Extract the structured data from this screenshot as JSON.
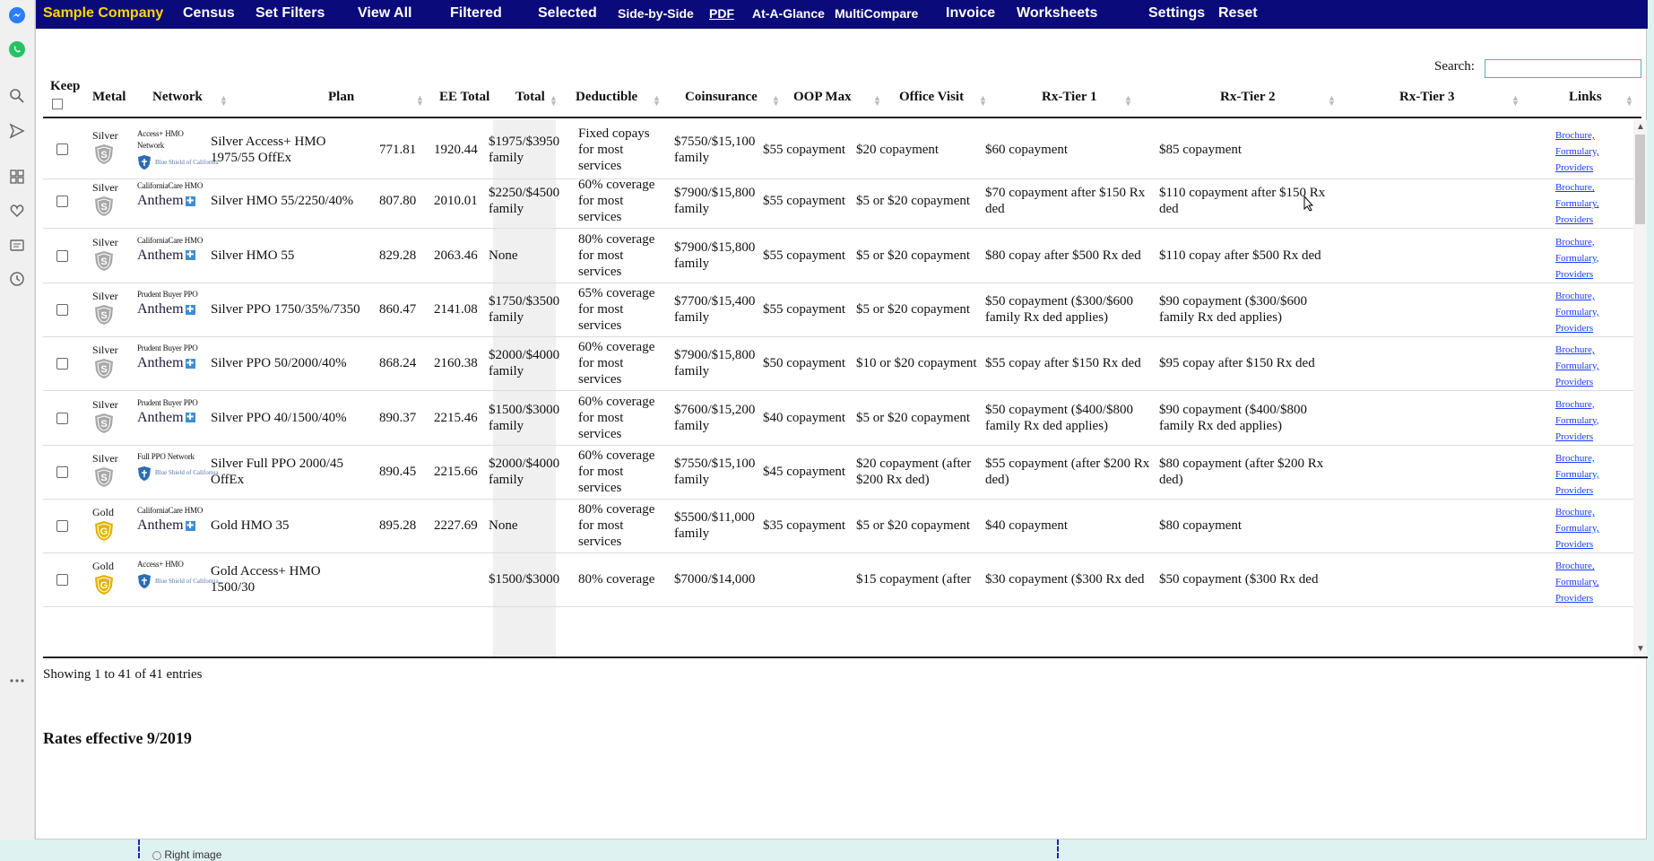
{
  "nav": {
    "items": [
      {
        "label": "Sample Company",
        "brand": true
      },
      {
        "label": "Census"
      },
      {
        "label": "Set Filters"
      },
      {
        "label": "View All"
      },
      {
        "label": "Filtered"
      },
      {
        "label": "Selected"
      },
      {
        "label": "Side-by-Side",
        "small": true
      },
      {
        "label": "PDF",
        "small": true,
        "underline": true
      },
      {
        "label": "At-A-Glance",
        "small": true
      },
      {
        "label": "MultiCompare",
        "small": true
      },
      {
        "label": "Invoice"
      },
      {
        "label": "Worksheets"
      },
      {
        "label": "Settings"
      },
      {
        "label": "Reset"
      }
    ]
  },
  "search": {
    "label": "Search:",
    "value": ""
  },
  "table": {
    "headers": [
      "Keep",
      "Metal",
      "Network",
      "Plan",
      "EE Total",
      "Total",
      "Deductible",
      "Coinsurance",
      "OOP Max",
      "Office Visit",
      "Rx-Tier 1",
      "Rx-Tier 2",
      "Rx-Tier 3",
      "Links"
    ],
    "rows": [
      {
        "metal": "Silver",
        "network": [
          "Access+ HMO",
          "Network"
        ],
        "carrier": "Blue Shield of California",
        "plan": "Silver Access+ HMO 1975/55 OffEx",
        "ee_total": "771.81",
        "total": "1920.44",
        "deductible": "$1975/$3950 family",
        "coinsurance": "Fixed copays for most services",
        "oop_max": "$7550/$15,100 family",
        "office_visit": "$55 copayment",
        "rx1": "$20 copayment",
        "rx2": "$60 copayment",
        "rx3": "$85 copayment"
      },
      {
        "metal": "Silver",
        "network": [
          "CaliforniaCare HMO"
        ],
        "carrier": "Anthem",
        "plan": "Silver HMO 55/2250/40%",
        "ee_total": "807.80",
        "total": "2010.01",
        "deductible": "$2250/$4500 family",
        "coinsurance": "60% coverage for most services",
        "oop_max": "$7900/$15,800 family",
        "office_visit": "$55 copayment",
        "rx1": "$5 or $20 copayment",
        "rx2": "$70 copayment after $150 Rx ded",
        "rx3": "$110 copayment after $150 Rx ded"
      },
      {
        "metal": "Silver",
        "network": [
          "CaliforniaCare HMO"
        ],
        "carrier": "Anthem",
        "plan": "Silver HMO 55",
        "ee_total": "829.28",
        "total": "2063.46",
        "deductible": "None",
        "coinsurance": "80% coverage for most services",
        "oop_max": "$7900/$15,800 family",
        "office_visit": "$55 copayment",
        "rx1": "$5 or $20 copayment",
        "rx2": "$80 copay after $500 Rx ded",
        "rx3": "$110 copay after $500 Rx ded"
      },
      {
        "metal": "Silver",
        "network": [
          "Prudent Buyer PPO"
        ],
        "carrier": "Anthem",
        "plan": "Silver PPO 1750/35%/7350",
        "ee_total": "860.47",
        "total": "2141.08",
        "deductible": "$1750/$3500 family",
        "coinsurance": "65% coverage for most services",
        "oop_max": "$7700/$15,400 family",
        "office_visit": "$55 copayment",
        "rx1": "$5 or $20 copayment",
        "rx2": "$50 copayment ($300/$600 family Rx ded applies)",
        "rx3": "$90 copayment ($300/$600 family Rx ded applies)"
      },
      {
        "metal": "Silver",
        "network": [
          "Prudent Buyer PPO"
        ],
        "carrier": "Anthem",
        "plan": "Silver PPO 50/2000/40%",
        "ee_total": "868.24",
        "total": "2160.38",
        "deductible": "$2000/$4000 family",
        "coinsurance": "60% coverage for most services",
        "oop_max": "$7900/$15,800 family",
        "office_visit": "$50 copayment",
        "rx1": "$10 or $20 copayment",
        "rx2": "$55 copay after $150 Rx ded",
        "rx3": "$95 copay after $150 Rx ded"
      },
      {
        "metal": "Silver",
        "network": [
          "Prudent Buyer PPO"
        ],
        "carrier": "Anthem",
        "plan": "Silver PPO 40/1500/40%",
        "ee_total": "890.37",
        "total": "2215.46",
        "deductible": "$1500/$3000 family",
        "coinsurance": "60% coverage for most services",
        "oop_max": "$7600/$15,200 family",
        "office_visit": "$40 copayment",
        "rx1": "$5 or $20 copayment",
        "rx2": "$50 copayment ($400/$800 family Rx ded applies)",
        "rx3": "$90 copayment ($400/$800 family Rx ded applies)"
      },
      {
        "metal": "Silver",
        "network": [
          "Full PPO Network"
        ],
        "carrier": "Blue Shield of California",
        "plan": "Silver Full PPO 2000/45 OffEx",
        "ee_total": "890.45",
        "total": "2215.66",
        "deductible": "$2000/$4000 family",
        "coinsurance": "60% coverage for most services",
        "oop_max": "$7550/$15,100 family",
        "office_visit": "$45 copayment",
        "rx1": "$20 copayment (after $200 Rx ded)",
        "rx2": "$55 copayment (after $200 Rx ded)",
        "rx3": "$80 copayment (after $200 Rx ded)"
      },
      {
        "metal": "Gold",
        "network": [
          "CaliforniaCare HMO"
        ],
        "carrier": "Anthem",
        "plan": "Gold HMO 35",
        "ee_total": "895.28",
        "total": "2227.69",
        "deductible": "None",
        "coinsurance": "80% coverage for most services",
        "oop_max": "$5500/$11,000 family",
        "office_visit": "$35 copayment",
        "rx1": "$5 or $20 copayment",
        "rx2": "$40 copayment",
        "rx3": "$80 copayment"
      },
      {
        "metal": "Gold",
        "network": [
          "Access+ HMO"
        ],
        "carrier": "Blue Shield of California",
        "plan": "Gold Access+ HMO 1500/30",
        "ee_total": "",
        "total": "",
        "deductible": "$1500/$3000",
        "coinsurance": "80% coverage",
        "oop_max": "$7000/$14,000",
        "office_visit": "",
        "rx1": "$15 copayment (after",
        "rx2": "$30 copayment ($300 Rx ded",
        "rx3": "$50 copayment ($300 Rx ded"
      }
    ],
    "links": [
      "Brochure,",
      "Formulary,",
      "Providers"
    ]
  },
  "footer": {
    "showing": "Showing 1 to 41 of 41 entries",
    "rates": "Rates effective 9/2019"
  },
  "underlay": {
    "text": "Right image"
  },
  "sidebar": {
    "icons": [
      "messenger-icon",
      "whatsapp-icon",
      "search-icon",
      "send-icon",
      "apps-icon",
      "heart-icon",
      "wallet-icon",
      "history-icon",
      "more-icon"
    ]
  },
  "colors": {
    "nav_bg": "#0b0a7a",
    "brand": "#ffd700",
    "link": "#1a3aff",
    "silver": "#a8a8a8",
    "gold": "#e2b400"
  }
}
